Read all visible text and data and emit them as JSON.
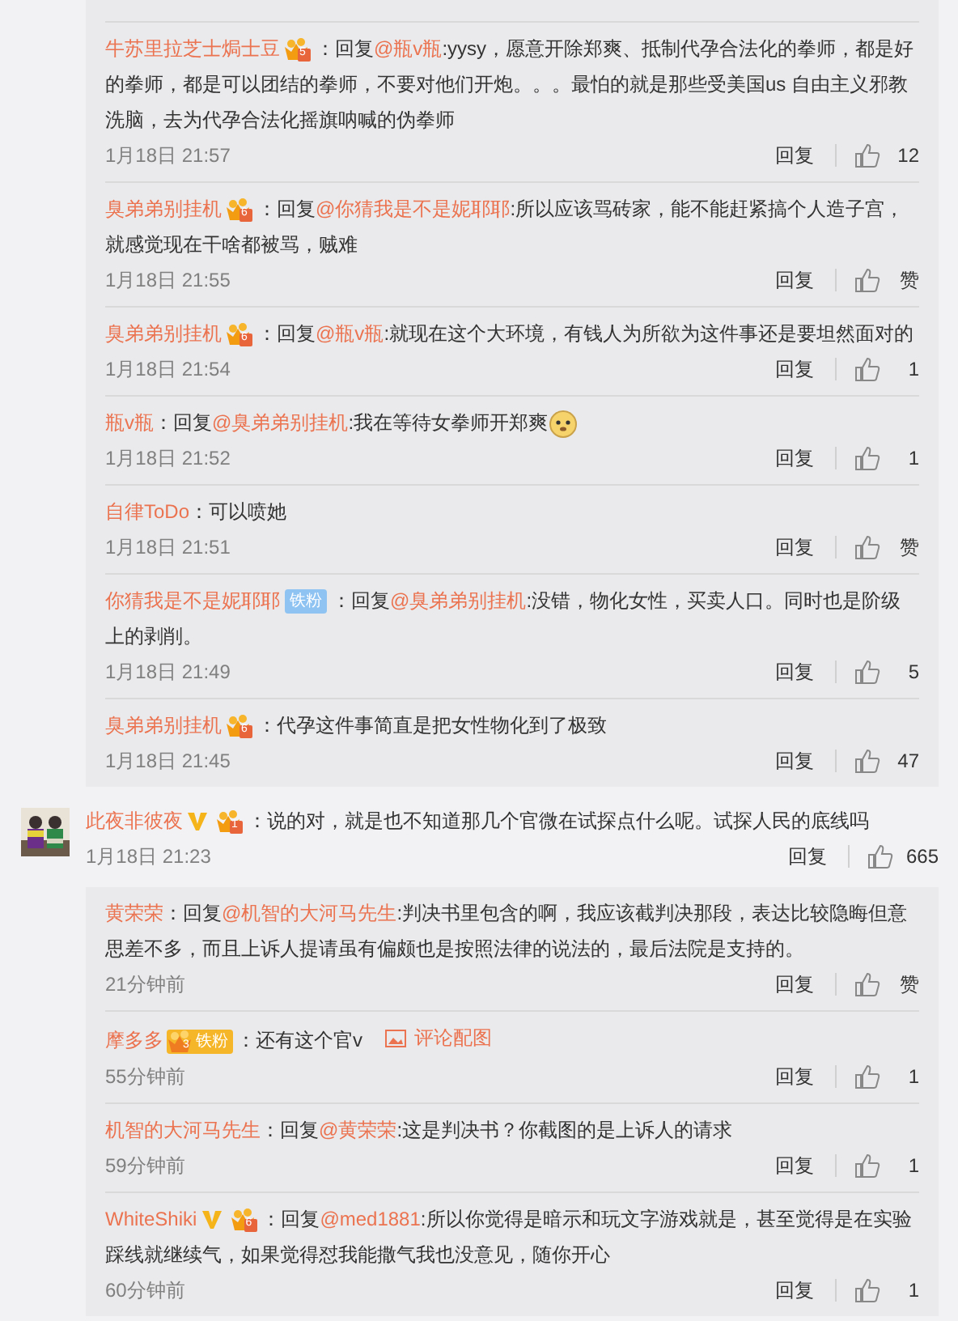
{
  "thread_above": {
    "replies": [
      {
        "user": "牛苏里拉芝士焗士豆",
        "badges": [
          {
            "kind": "crown",
            "level": "5"
          }
        ],
        "content": [
          {
            "kind": "plain",
            "text": "：回复"
          },
          {
            "kind": "mention",
            "text": "@瓶v瓶"
          },
          {
            "kind": "plain",
            "text": ":yysy，愿意开除郑爽、抵制代孕合法化的拳师，都是好的拳师，都是可以团结的拳师，不要对他们开炮。。。最怕的就是那些受美国us 自由主义邪教洗脑，去为代孕合法化摇旗呐喊的伪拳师"
          }
        ],
        "time": "1月18日 21:57",
        "reply": "回复",
        "likes": "12"
      },
      {
        "user": "臭弟弟别挂机",
        "badges": [
          {
            "kind": "crown",
            "level": "6"
          }
        ],
        "content": [
          {
            "kind": "plain",
            "text": "：回复"
          },
          {
            "kind": "mention",
            "text": "@你猜我是不是妮耶耶"
          },
          {
            "kind": "plain",
            "text": ":所以应该骂砖家，能不能赶紧搞个人造子宫，就感觉现在干啥都被骂，贼难"
          }
        ],
        "time": "1月18日 21:55",
        "reply": "回复",
        "likes": "赞"
      },
      {
        "user": "臭弟弟别挂机",
        "badges": [
          {
            "kind": "crown",
            "level": "6"
          }
        ],
        "content": [
          {
            "kind": "plain",
            "text": "：回复"
          },
          {
            "kind": "mention",
            "text": "@瓶v瓶"
          },
          {
            "kind": "plain",
            "text": ":就现在这个大环境，有钱人为所欲为这件事还是要坦然面对的"
          }
        ],
        "time": "1月18日 21:54",
        "reply": "回复",
        "likes": "1"
      },
      {
        "user": "瓶v瓶",
        "content": [
          {
            "kind": "plain",
            "text": "：回复"
          },
          {
            "kind": "mention",
            "text": "@臭弟弟别挂机"
          },
          {
            "kind": "plain",
            "text": ":我在等待女拳师开郑爽"
          },
          {
            "kind": "emoji"
          }
        ],
        "time": "1月18日 21:52",
        "reply": "回复",
        "likes": "1"
      },
      {
        "user": "自律ToDo",
        "content": [
          {
            "kind": "plain",
            "text": "：可以喷她"
          }
        ],
        "time": "1月18日 21:51",
        "reply": "回复",
        "likes": "赞"
      },
      {
        "user": "你猜我是不是妮耶耶",
        "badges": [
          {
            "kind": "fan",
            "text": "铁粉"
          }
        ],
        "content": [
          {
            "kind": "plain",
            "text": "：回复"
          },
          {
            "kind": "mention",
            "text": "@臭弟弟别挂机"
          },
          {
            "kind": "plain",
            "text": ":没错，物化女性，买卖人口。同时也是阶级上的剥削。"
          }
        ],
        "time": "1月18日 21:49",
        "reply": "回复",
        "likes": "5"
      },
      {
        "user": "臭弟弟别挂机",
        "badges": [
          {
            "kind": "crown",
            "level": "6"
          }
        ],
        "content": [
          {
            "kind": "plain",
            "text": "：代孕这件事简直是把女性物化到了极致"
          }
        ],
        "time": "1月18日 21:45",
        "reply": "回复",
        "likes": "47"
      }
    ]
  },
  "comment": {
    "user": "此夜非彼夜",
    "badges": [
      {
        "kind": "verified"
      },
      {
        "kind": "crown",
        "level": "1"
      }
    ],
    "content": [
      {
        "kind": "plain",
        "text": "：说的对，就是也不知道那几个官微在试探点什么呢。试探人民的底线吗"
      }
    ],
    "time": "1月18日 21:23",
    "reply": "回复",
    "likes": "665"
  },
  "thread_below": {
    "replies": [
      {
        "user": "黄荣荣",
        "content": [
          {
            "kind": "plain",
            "text": "：回复"
          },
          {
            "kind": "mention",
            "text": "@机智的大河马先生"
          },
          {
            "kind": "plain",
            "text": ":判决书里包含的啊，我应该截判决那段，表达比较隐晦但意思差不多，而且上诉人提请虽有偏颇也是按照法律的说法的，最后法院是支持的。"
          }
        ],
        "time": "21分钟前",
        "reply": "回复",
        "likes": "赞"
      },
      {
        "user": "摩多多",
        "badges": [
          {
            "kind": "crown_fan",
            "level": "3",
            "text": "铁粉"
          }
        ],
        "content": [
          {
            "kind": "plain",
            "text": "：还有这个官v"
          },
          {
            "kind": "image_link",
            "text": "评论配图"
          }
        ],
        "time": "55分钟前",
        "reply": "回复",
        "likes": "1"
      },
      {
        "user": "机智的大河马先生",
        "content": [
          {
            "kind": "plain",
            "text": "：回复"
          },
          {
            "kind": "mention",
            "text": "@黄荣荣"
          },
          {
            "kind": "plain",
            "text": ":这是判决书？你截图的是上诉人的请求"
          }
        ],
        "time": "59分钟前",
        "reply": "回复",
        "likes": "1"
      },
      {
        "user": "WhiteShiki",
        "badges": [
          {
            "kind": "verified"
          },
          {
            "kind": "crown",
            "level": "6"
          }
        ],
        "content": [
          {
            "kind": "plain",
            "text": "：回复"
          },
          {
            "kind": "mention",
            "text": "@med1881"
          },
          {
            "kind": "plain",
            "text": ":所以你觉得是暗示和玩文字游戏就是，甚至觉得是在实验踩线就继续气，如果觉得怼我能撒气我也没意见，随你开心"
          }
        ],
        "time": "60分钟前",
        "reply": "回复",
        "likes": "1"
      }
    ]
  }
}
